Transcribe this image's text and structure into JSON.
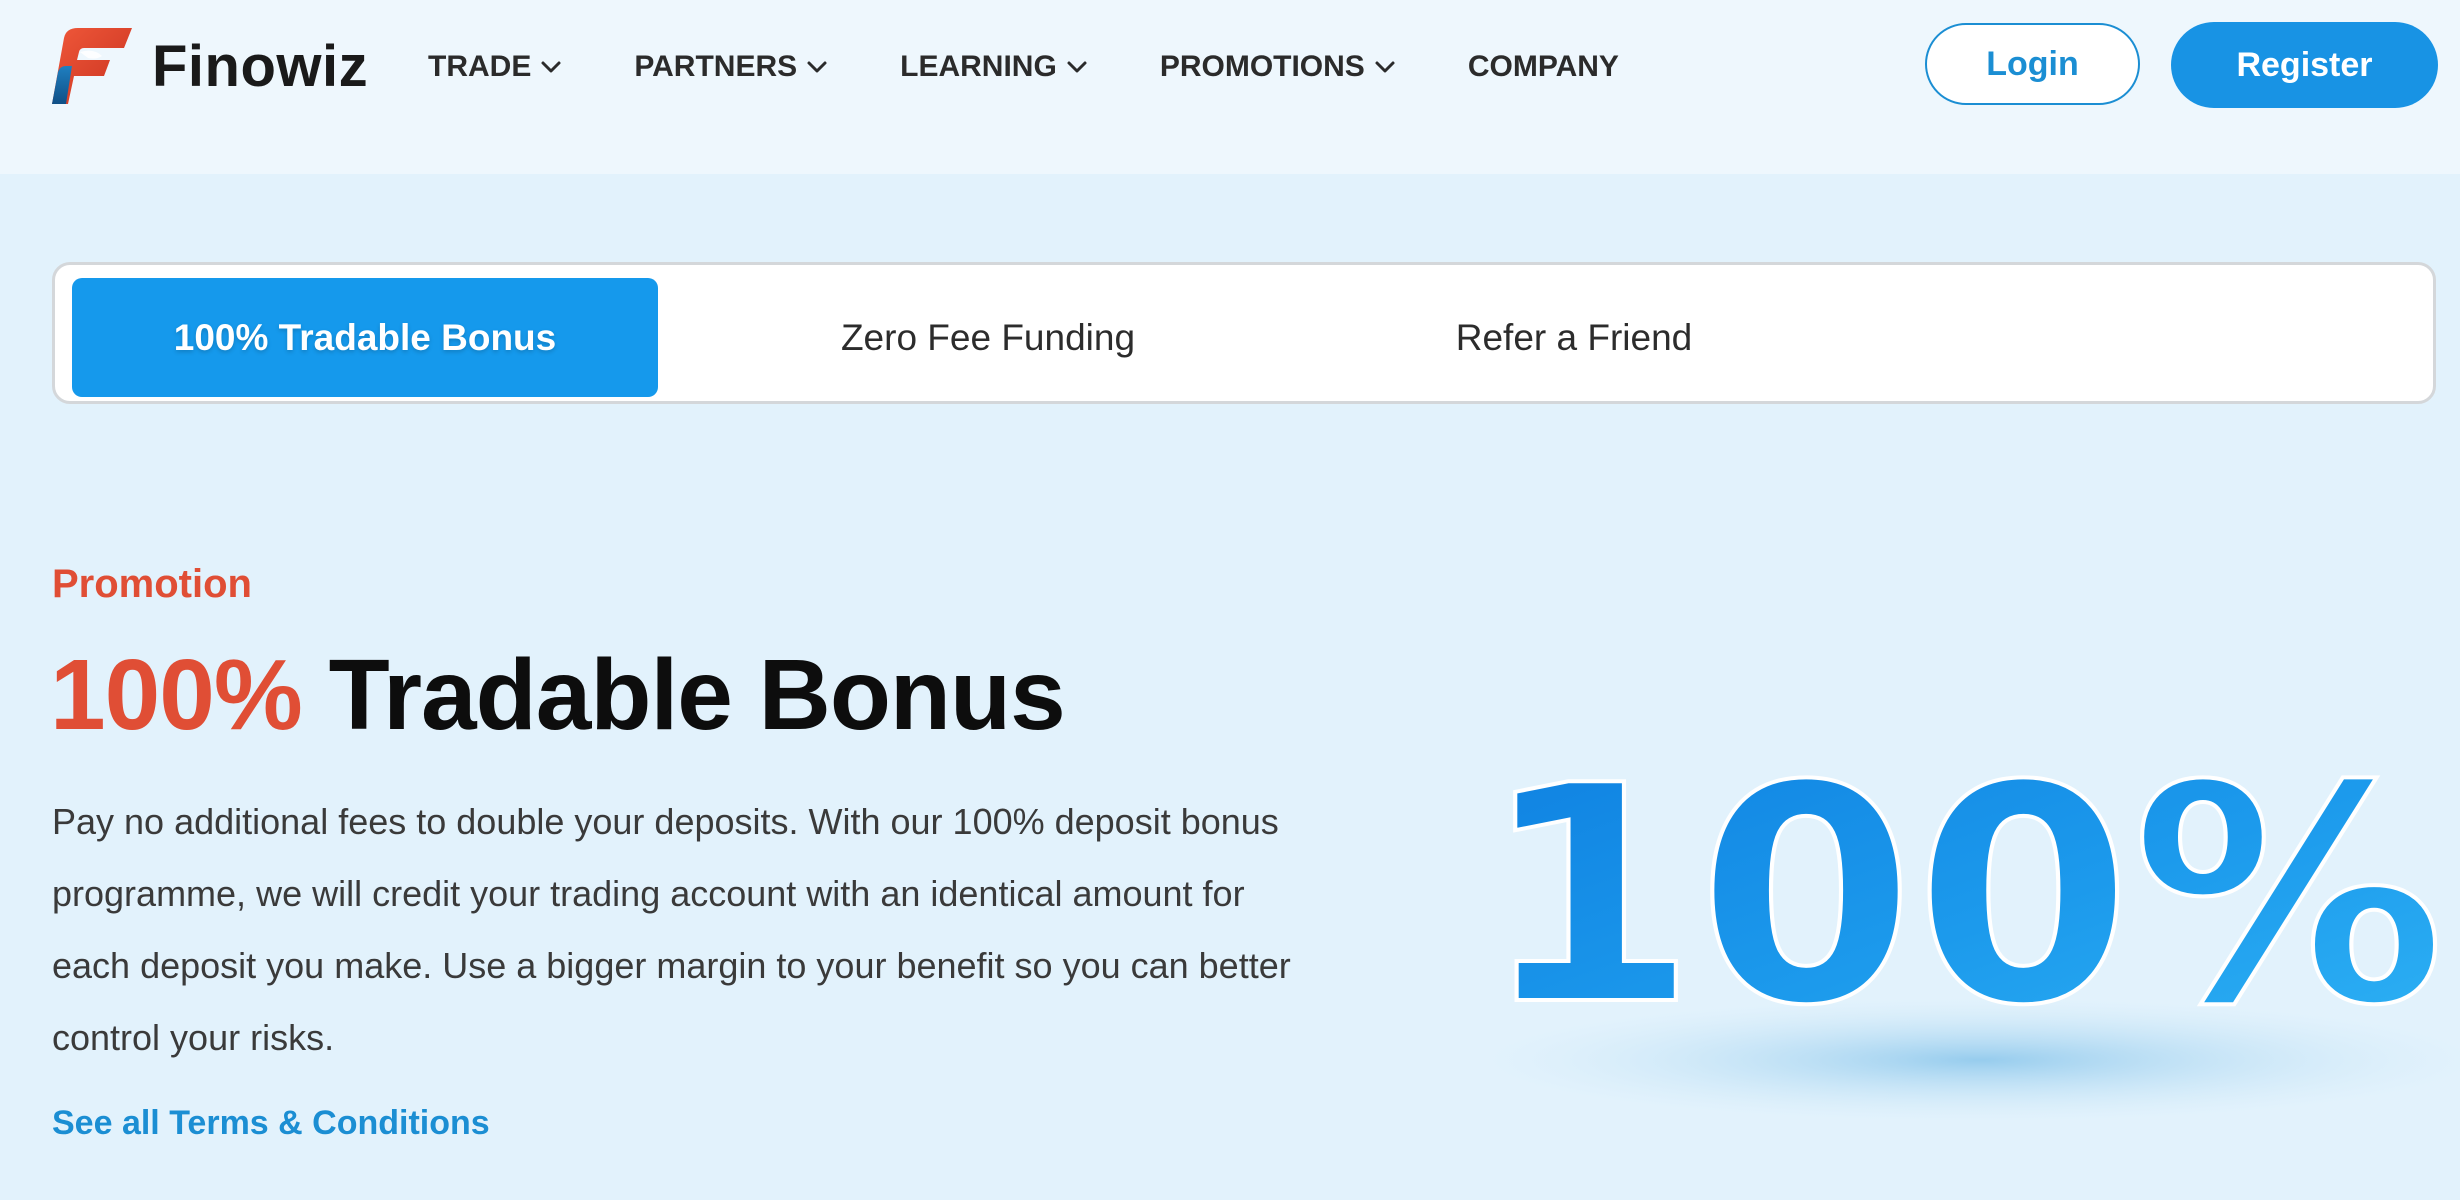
{
  "brand": {
    "name": "Finowiz",
    "logo_icon": "finowiz-logo-icon",
    "colors": {
      "primary": "#1893e4",
      "accent": "#e04e35"
    }
  },
  "nav": {
    "items": [
      {
        "label": "TRADE",
        "has_dropdown": true
      },
      {
        "label": "PARTNERS",
        "has_dropdown": true
      },
      {
        "label": "LEARNING",
        "has_dropdown": true
      },
      {
        "label": "PROMOTIONS",
        "has_dropdown": true
      },
      {
        "label": "COMPANY",
        "has_dropdown": false
      }
    ],
    "login_label": "Login",
    "register_label": "Register"
  },
  "tabs": [
    {
      "label": "100% Tradable Bonus",
      "active": true
    },
    {
      "label": "Zero Fee Funding",
      "active": false
    },
    {
      "label": "Refer a Friend",
      "active": false
    }
  ],
  "hero": {
    "eyebrow": "Promotion",
    "title_accent": "100%",
    "title_rest": "Tradable Bonus",
    "description": "Pay no additional fees to double your deposits. With our 100% deposit bonus programme, we will credit your trading account with an identical amount for each deposit you make. Use a bigger margin to your benefit so you can better control your risks.",
    "terms_link": "See all Terms & Conditions",
    "graphic_text": "100%"
  }
}
